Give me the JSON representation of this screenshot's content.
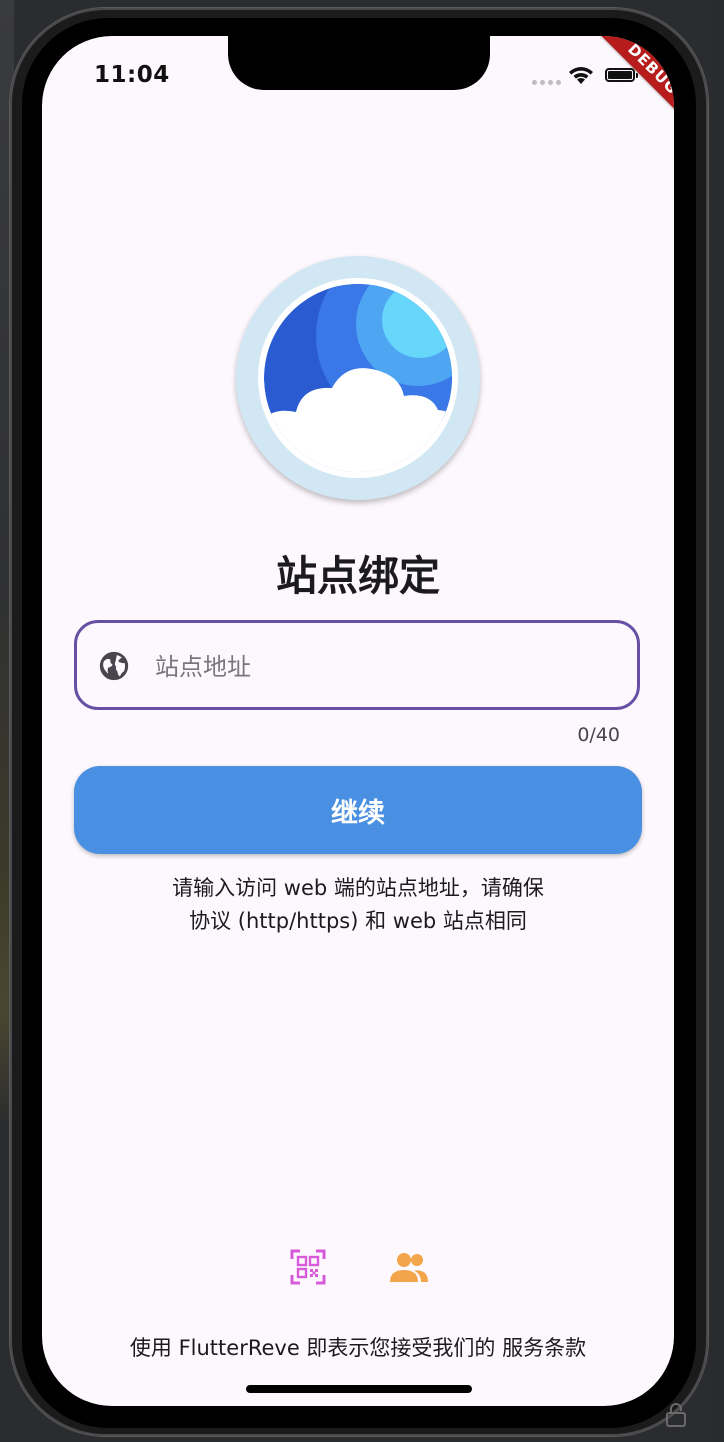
{
  "status_bar": {
    "time": "11:04"
  },
  "debug_banner": "DEBUG",
  "page": {
    "title": "站点绑定"
  },
  "site_input": {
    "placeholder": "站点地址",
    "value": "",
    "counter": "0/40"
  },
  "continue_button": {
    "label": "继续"
  },
  "hint": {
    "line1": "请输入访问 web 端的站点地址，请确保",
    "line2": "协议 (http/https) 和 web 站点相同"
  },
  "bottom_icons": {
    "qr": "qr-code-scanner-icon",
    "users": "users-icon"
  },
  "footer": {
    "prefix": "使用 FlutterReve 即表示您接受我们的 ",
    "link": "服务条款"
  },
  "colors": {
    "accent": "#4a90e2",
    "input_border": "#6750a4",
    "qr_icon": "#d65bd9",
    "users_icon": "#f2a54a",
    "debug_ribbon": "#b71c1c"
  }
}
